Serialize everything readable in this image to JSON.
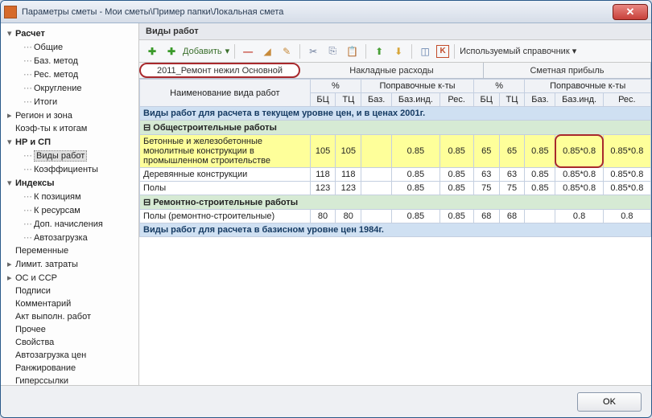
{
  "window": {
    "title": "Параметры сметы - Мои сметы\\Пример папки\\Локальная смета"
  },
  "sidebar": {
    "items": [
      {
        "label": "Расчет",
        "lvl": 1,
        "arrow": "▾",
        "bold": true
      },
      {
        "label": "Общие",
        "lvl": 2
      },
      {
        "label": "Баз. метод",
        "lvl": 2
      },
      {
        "label": "Рес. метод",
        "lvl": 2
      },
      {
        "label": "Округление",
        "lvl": 2
      },
      {
        "label": "Итоги",
        "lvl": 2
      },
      {
        "label": "Регион и зона",
        "lvl": 1,
        "arrow": "▸"
      },
      {
        "label": "Коэф-ты к итогам",
        "lvl": 1
      },
      {
        "label": "НР и СП",
        "lvl": 1,
        "arrow": "▾",
        "bold": true
      },
      {
        "label": "Виды работ",
        "lvl": 2,
        "sel": true
      },
      {
        "label": "Коэффициенты",
        "lvl": 2
      },
      {
        "label": "Индексы",
        "lvl": 1,
        "arrow": "▾",
        "bold": true
      },
      {
        "label": "К позициям",
        "lvl": 2
      },
      {
        "label": "К ресурсам",
        "lvl": 2
      },
      {
        "label": "Доп. начисления",
        "lvl": 2
      },
      {
        "label": "Автозагрузка",
        "lvl": 2
      },
      {
        "label": "Переменные",
        "lvl": 1
      },
      {
        "label": "Лимит. затраты",
        "lvl": 1,
        "arrow": "▸"
      },
      {
        "label": "ОС и ССР",
        "lvl": 1,
        "arrow": "▸"
      },
      {
        "label": "Подписи",
        "lvl": 1
      },
      {
        "label": "Комментарий",
        "lvl": 1
      },
      {
        "label": "Акт выполн. работ",
        "lvl": 1
      },
      {
        "label": "Прочее",
        "lvl": 1
      },
      {
        "label": "Свойства",
        "lvl": 1
      },
      {
        "label": "Автозагрузка цен",
        "lvl": 1
      },
      {
        "label": "Ранжирование",
        "lvl": 1
      },
      {
        "label": "Гиперссылки",
        "lvl": 1
      }
    ]
  },
  "section": {
    "title": "Виды работ"
  },
  "toolbar": {
    "add": "Добавить",
    "ref": "Используемый справочник"
  },
  "tabs": {
    "active": "2011_Ремонт нежил Основной",
    "g1": "Накладные расходы",
    "g2": "Сметная прибыль"
  },
  "cols": {
    "name": "Наименование вида работ",
    "pct": "%",
    "pk": "Поправочные к-ты",
    "bc": "БЦ",
    "tc": "ТЦ",
    "baz": "Баз.",
    "bazind": "Баз.инд.",
    "res": "Рес."
  },
  "bands": {
    "b1": "Виды работ для расчета в текущем уровне цен, и в ценах 2001г.",
    "g1": "Общестроительные работы",
    "g2": "Ремонтно-строительные работы",
    "b2": "Виды работ для расчета в базисном уровне цен 1984г."
  },
  "rows": [
    {
      "name": "Бетонные и железобетонные монолитные конструкции в промышленном строительстве",
      "bc": "105",
      "tc": "105",
      "baz": "",
      "bazind": "0.85",
      "res": "0.85",
      "bc2": "65",
      "tc2": "65",
      "baz2": "0.85",
      "bazind2": "0.85*0.8",
      "res2": "0.85*0.8",
      "hl": true,
      "mark": true
    },
    {
      "name": "Деревянные конструкции",
      "bc": "118",
      "tc": "118",
      "baz": "",
      "bazind": "0.85",
      "res": "0.85",
      "bc2": "63",
      "tc2": "63",
      "baz2": "0.85",
      "bazind2": "0.85*0.8",
      "res2": "0.85*0.8"
    },
    {
      "name": "Полы",
      "bc": "123",
      "tc": "123",
      "baz": "",
      "bazind": "0.85",
      "res": "0.85",
      "bc2": "75",
      "tc2": "75",
      "baz2": "0.85",
      "bazind2": "0.85*0.8",
      "res2": "0.85*0.8"
    }
  ],
  "rows2": [
    {
      "name": "Полы (ремонтно-строительные)",
      "bc": "80",
      "tc": "80",
      "baz": "",
      "bazind": "0.85",
      "res": "0.85",
      "bc2": "68",
      "tc2": "68",
      "baz2": "",
      "bazind2": "0.8",
      "res2": "0.8"
    }
  ],
  "footer": {
    "ok": "OK"
  },
  "chart_data": {
    "type": "table",
    "title": "Виды работ — НР и СП",
    "columns": [
      "Наименование",
      "НР БЦ %",
      "НР ТЦ %",
      "НР Баз.",
      "НР Баз.инд.",
      "НР Рес.",
      "СП БЦ %",
      "СП ТЦ %",
      "СП Баз.",
      "СП Баз.инд.",
      "СП Рес."
    ],
    "rows": [
      [
        "Бетонные и железобетонные монолитные конструкции в промышленном строительстве",
        105,
        105,
        null,
        0.85,
        0.85,
        65,
        65,
        0.85,
        "0.85*0.8",
        "0.85*0.8"
      ],
      [
        "Деревянные конструкции",
        118,
        118,
        null,
        0.85,
        0.85,
        63,
        63,
        0.85,
        "0.85*0.8",
        "0.85*0.8"
      ],
      [
        "Полы",
        123,
        123,
        null,
        0.85,
        0.85,
        75,
        75,
        0.85,
        "0.85*0.8",
        "0.85*0.8"
      ],
      [
        "Полы (ремонтно-строительные)",
        80,
        80,
        null,
        0.85,
        0.85,
        68,
        68,
        null,
        0.8,
        0.8
      ]
    ]
  }
}
